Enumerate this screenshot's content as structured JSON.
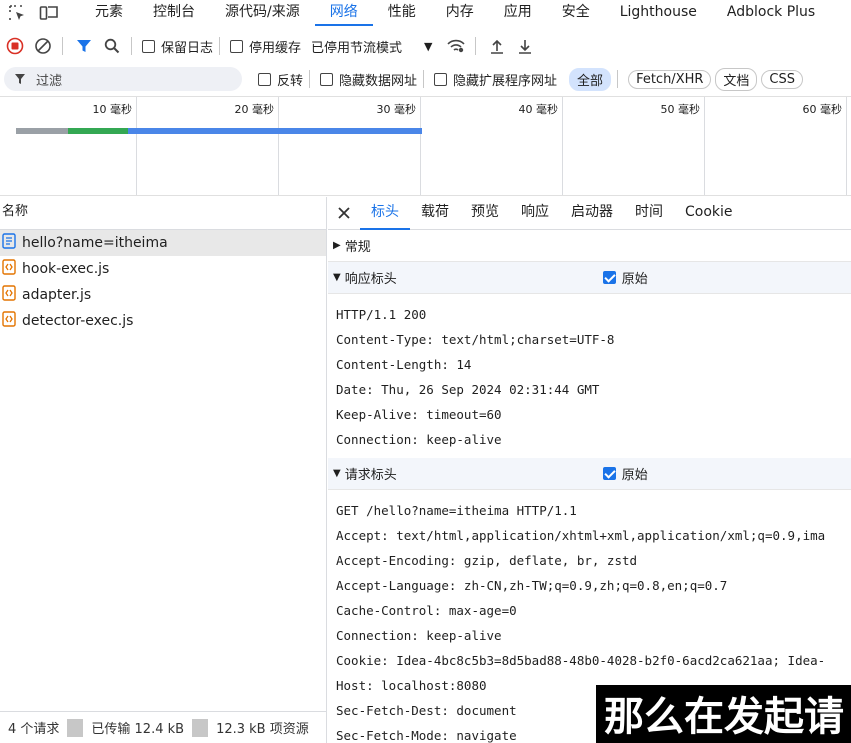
{
  "top_tabs": [
    "元素",
    "控制台",
    "源代码/来源",
    "网络",
    "性能",
    "内存",
    "应用",
    "安全",
    "Lighthouse",
    "Adblock Plus"
  ],
  "active_top_tab": "网络",
  "toolbar": {
    "preserve_log": "保留日志",
    "disable_cache": "停用缓存",
    "throttle": "已停用节流模式"
  },
  "filter": {
    "placeholder": "过滤",
    "invert": "反转",
    "hide_data_urls": "隐藏数据网址",
    "hide_ext_urls": "隐藏扩展程序网址",
    "types": [
      "全部",
      "Fetch/XHR",
      "文档",
      "CSS"
    ]
  },
  "timeline": {
    "ticks": [
      "10 毫秒",
      "20 毫秒",
      "30 毫秒",
      "40 毫秒",
      "50 毫秒",
      "60 毫秒"
    ]
  },
  "request_list": {
    "header": "名称",
    "items": [
      {
        "name": "hello?name=itheima",
        "kind": "document"
      },
      {
        "name": "hook-exec.js",
        "kind": "script"
      },
      {
        "name": "adapter.js",
        "kind": "script"
      },
      {
        "name": "detector-exec.js",
        "kind": "script"
      }
    ]
  },
  "status": {
    "requests": "4 个请求",
    "transferred": "已传输 12.4 kB",
    "resources": "12.3 kB 项资源"
  },
  "detail_tabs": [
    "标头",
    "载荷",
    "预览",
    "响应",
    "启动器",
    "时间",
    "Cookie"
  ],
  "sections": {
    "general": "常规",
    "response_headers": "响应标头",
    "request_headers": "请求标头",
    "raw_label": "原始"
  },
  "response_lines": [
    "HTTP/1.1 200",
    "Content-Type: text/html;charset=UTF-8",
    "Content-Length: 14",
    "Date: Thu, 26 Sep 2024 02:31:44 GMT",
    "Keep-Alive: timeout=60",
    "Connection: keep-alive"
  ],
  "request_lines": [
    "GET /hello?name=itheima HTTP/1.1",
    "Accept: text/html,application/xhtml+xml,application/xml;q=0.9,ima",
    "Accept-Encoding: gzip, deflate, br, zstd",
    "Accept-Language: zh-CN,zh-TW;q=0.9,zh;q=0.8,en;q=0.7",
    "Cache-Control: max-age=0",
    "Connection: keep-alive",
    "Cookie: Idea-4bc8c5b3=8d5bad88-48b0-4028-b2f0-6acd2ca621aa; Idea-",
    "Host: localhost:8080",
    "Sec-Fetch-Dest: document",
    "Sec-Fetch-Mode: navigate"
  ],
  "subtitle": "那么在发起请",
  "colors": {
    "accent": "#1a73e8",
    "record": "#d93025"
  }
}
